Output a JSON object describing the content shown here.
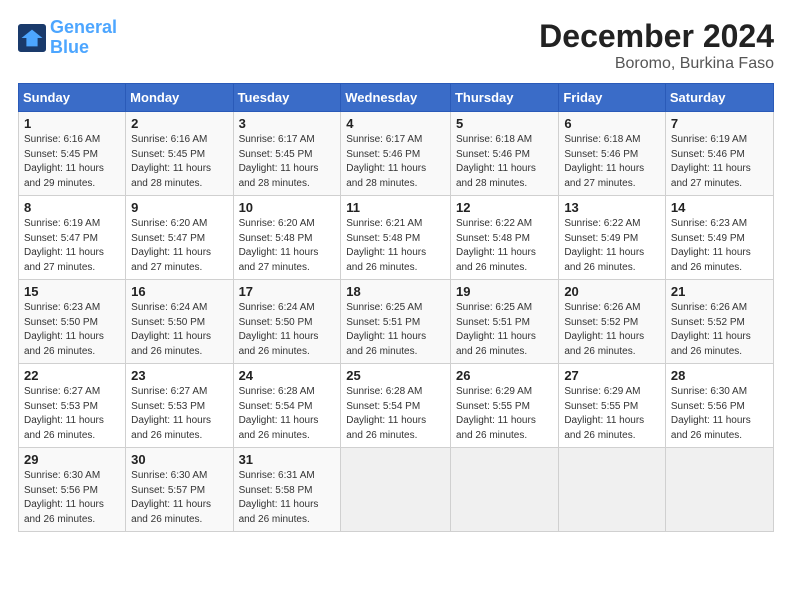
{
  "header": {
    "logo_line1": "General",
    "logo_line2": "Blue",
    "title": "December 2024",
    "subtitle": "Boromo, Burkina Faso"
  },
  "days_of_week": [
    "Sunday",
    "Monday",
    "Tuesday",
    "Wednesday",
    "Thursday",
    "Friday",
    "Saturday"
  ],
  "weeks": [
    [
      {
        "day": "1",
        "info": "Sunrise: 6:16 AM\nSunset: 5:45 PM\nDaylight: 11 hours\nand 29 minutes."
      },
      {
        "day": "2",
        "info": "Sunrise: 6:16 AM\nSunset: 5:45 PM\nDaylight: 11 hours\nand 28 minutes."
      },
      {
        "day": "3",
        "info": "Sunrise: 6:17 AM\nSunset: 5:45 PM\nDaylight: 11 hours\nand 28 minutes."
      },
      {
        "day": "4",
        "info": "Sunrise: 6:17 AM\nSunset: 5:46 PM\nDaylight: 11 hours\nand 28 minutes."
      },
      {
        "day": "5",
        "info": "Sunrise: 6:18 AM\nSunset: 5:46 PM\nDaylight: 11 hours\nand 28 minutes."
      },
      {
        "day": "6",
        "info": "Sunrise: 6:18 AM\nSunset: 5:46 PM\nDaylight: 11 hours\nand 27 minutes."
      },
      {
        "day": "7",
        "info": "Sunrise: 6:19 AM\nSunset: 5:46 PM\nDaylight: 11 hours\nand 27 minutes."
      }
    ],
    [
      {
        "day": "8",
        "info": "Sunrise: 6:19 AM\nSunset: 5:47 PM\nDaylight: 11 hours\nand 27 minutes."
      },
      {
        "day": "9",
        "info": "Sunrise: 6:20 AM\nSunset: 5:47 PM\nDaylight: 11 hours\nand 27 minutes."
      },
      {
        "day": "10",
        "info": "Sunrise: 6:20 AM\nSunset: 5:48 PM\nDaylight: 11 hours\nand 27 minutes."
      },
      {
        "day": "11",
        "info": "Sunrise: 6:21 AM\nSunset: 5:48 PM\nDaylight: 11 hours\nand 26 minutes."
      },
      {
        "day": "12",
        "info": "Sunrise: 6:22 AM\nSunset: 5:48 PM\nDaylight: 11 hours\nand 26 minutes."
      },
      {
        "day": "13",
        "info": "Sunrise: 6:22 AM\nSunset: 5:49 PM\nDaylight: 11 hours\nand 26 minutes."
      },
      {
        "day": "14",
        "info": "Sunrise: 6:23 AM\nSunset: 5:49 PM\nDaylight: 11 hours\nand 26 minutes."
      }
    ],
    [
      {
        "day": "15",
        "info": "Sunrise: 6:23 AM\nSunset: 5:50 PM\nDaylight: 11 hours\nand 26 minutes."
      },
      {
        "day": "16",
        "info": "Sunrise: 6:24 AM\nSunset: 5:50 PM\nDaylight: 11 hours\nand 26 minutes."
      },
      {
        "day": "17",
        "info": "Sunrise: 6:24 AM\nSunset: 5:50 PM\nDaylight: 11 hours\nand 26 minutes."
      },
      {
        "day": "18",
        "info": "Sunrise: 6:25 AM\nSunset: 5:51 PM\nDaylight: 11 hours\nand 26 minutes."
      },
      {
        "day": "19",
        "info": "Sunrise: 6:25 AM\nSunset: 5:51 PM\nDaylight: 11 hours\nand 26 minutes."
      },
      {
        "day": "20",
        "info": "Sunrise: 6:26 AM\nSunset: 5:52 PM\nDaylight: 11 hours\nand 26 minutes."
      },
      {
        "day": "21",
        "info": "Sunrise: 6:26 AM\nSunset: 5:52 PM\nDaylight: 11 hours\nand 26 minutes."
      }
    ],
    [
      {
        "day": "22",
        "info": "Sunrise: 6:27 AM\nSunset: 5:53 PM\nDaylight: 11 hours\nand 26 minutes."
      },
      {
        "day": "23",
        "info": "Sunrise: 6:27 AM\nSunset: 5:53 PM\nDaylight: 11 hours\nand 26 minutes."
      },
      {
        "day": "24",
        "info": "Sunrise: 6:28 AM\nSunset: 5:54 PM\nDaylight: 11 hours\nand 26 minutes."
      },
      {
        "day": "25",
        "info": "Sunrise: 6:28 AM\nSunset: 5:54 PM\nDaylight: 11 hours\nand 26 minutes."
      },
      {
        "day": "26",
        "info": "Sunrise: 6:29 AM\nSunset: 5:55 PM\nDaylight: 11 hours\nand 26 minutes."
      },
      {
        "day": "27",
        "info": "Sunrise: 6:29 AM\nSunset: 5:55 PM\nDaylight: 11 hours\nand 26 minutes."
      },
      {
        "day": "28",
        "info": "Sunrise: 6:30 AM\nSunset: 5:56 PM\nDaylight: 11 hours\nand 26 minutes."
      }
    ],
    [
      {
        "day": "29",
        "info": "Sunrise: 6:30 AM\nSunset: 5:56 PM\nDaylight: 11 hours\nand 26 minutes."
      },
      {
        "day": "30",
        "info": "Sunrise: 6:30 AM\nSunset: 5:57 PM\nDaylight: 11 hours\nand 26 minutes."
      },
      {
        "day": "31",
        "info": "Sunrise: 6:31 AM\nSunset: 5:58 PM\nDaylight: 11 hours\nand 26 minutes."
      },
      {
        "day": "",
        "info": ""
      },
      {
        "day": "",
        "info": ""
      },
      {
        "day": "",
        "info": ""
      },
      {
        "day": "",
        "info": ""
      }
    ]
  ]
}
